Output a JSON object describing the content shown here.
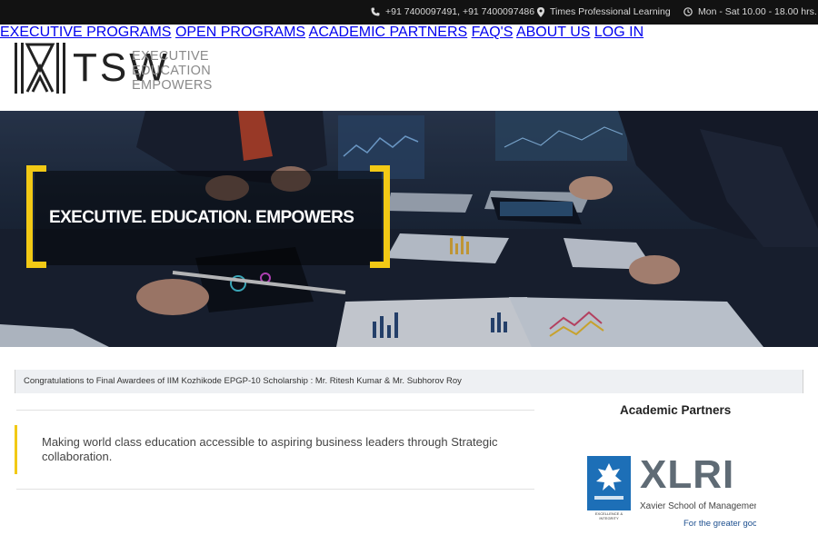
{
  "topbar": {
    "phone": "+91 7400097491, +91 7400097486",
    "company": "Times Professional Learning",
    "hours": "Mon - Sat 10.00 - 18.00 hrs."
  },
  "logo": {
    "name": "TSW",
    "tagline": [
      "EXECUTIVE",
      "EDUCATION",
      "EMPOWERS"
    ]
  },
  "nav": [
    {
      "label": "EXECUTIVE PROGRAMS"
    },
    {
      "label": "OPEN PROGRAMS"
    },
    {
      "label": "ACADEMIC PARTNERS"
    },
    {
      "label": "FAQ'S"
    },
    {
      "label": "ABOUT US"
    },
    {
      "label": "LOG IN"
    }
  ],
  "hero": {
    "title": "EXECUTIVE. EDUCATION. EMPOWERS"
  },
  "ticker": {
    "text": "Congratulations to Final Awardees of IIM Kozhikode EPGP-10 Scholarship : Mr. Ritesh Kumar & Mr. Subhorov Roy"
  },
  "mission": {
    "text": "Making world class education accessible to aspiring business leaders through Strategic collaboration."
  },
  "partners": {
    "title": "Academic Partners",
    "logo": {
      "letters": "XLRI",
      "subtitle": "Xavier School of Management",
      "motto": "For the greater good",
      "seal_text": "EXCELLENCE & INTEGRITY"
    }
  },
  "colors": {
    "accent": "#f2c915",
    "topbar_bg": "#121212",
    "xlri_blue": "#1d6fb7"
  }
}
